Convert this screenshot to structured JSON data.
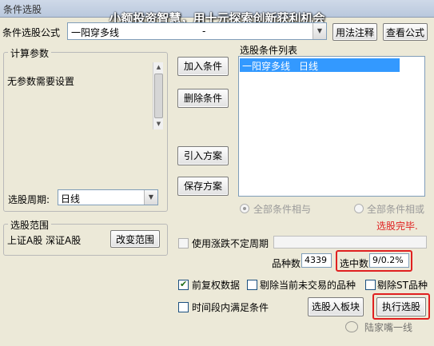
{
  "window": {
    "title": "条件选股",
    "banner": "小额投资智慧，用十元探索创新获利机会"
  },
  "formula": {
    "label": "条件选股公式",
    "value": "一阳穿多线",
    "value_suffix": "-",
    "usage_button": "用法注释",
    "view_button": "查看公式"
  },
  "params": {
    "group_title": "计算参数",
    "text": "无参数需要设置",
    "period_label": "选股周期:",
    "period_value": "日线"
  },
  "actions": {
    "add": "加入条件",
    "delete": "删除条件",
    "import": "引入方案",
    "save": "保存方案"
  },
  "conditions": {
    "title": "选股条件列表",
    "items": [
      {
        "name": "一阳穿多线",
        "period": "日线"
      }
    ],
    "radio_all_and": "全部条件相与",
    "radio_all_or": "全部条件相或",
    "status": "选股完毕."
  },
  "range": {
    "group_title": "选股范围",
    "text": "上证A股 深证A股",
    "change_button": "改变范围"
  },
  "options": {
    "variable_period_label": "使用涨跌不定周期",
    "count_label": "品种数",
    "count_value": "4339",
    "selected_label": "选中数",
    "selected_value": "9/0.2%",
    "forward_adjust_label": "前复权数据",
    "exclude_untraded_label": "剔除当前未交易的品种",
    "exclude_st_label": "剔除ST品种",
    "time_range_label": "时间段内满足条件",
    "select_to_block_button": "选股入板块",
    "execute_button": "执行选股"
  },
  "watermark": {
    "text": "陆家嘴一线"
  },
  "colors": {
    "status_red": "#e02020",
    "selection_blue": "#3399ff"
  }
}
